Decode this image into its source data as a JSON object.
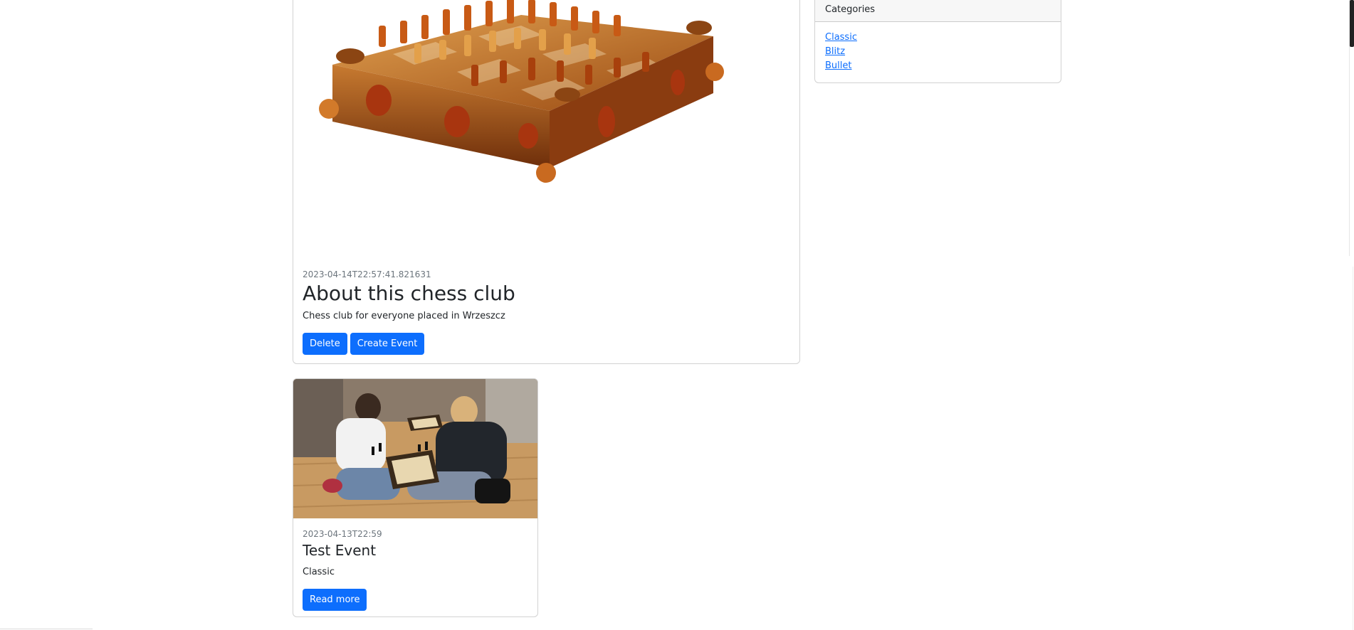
{
  "club": {
    "image_alt": "Amber chess set",
    "date": "2023-04-14T22:57:41.821631",
    "title": "About this chess club",
    "description": "Chess club for everyone placed in Wrzeszcz",
    "delete_label": "Delete",
    "create_event_label": "Create Event"
  },
  "event": {
    "image_alt": "Two boys playing chess on the floor",
    "date": "2023-04-13T22:59",
    "title": "Test Event",
    "category": "Classic",
    "read_more_label": "Read more"
  },
  "categories": {
    "header": "Categories",
    "items": [
      "Classic",
      "Blitz",
      "Bullet"
    ]
  },
  "colors": {
    "primary": "#0d6efd",
    "muted": "#6c757d",
    "text": "#212529",
    "amber": "#b5651d"
  },
  "icons": {
    "scrollbar": "scrollbar-thumb"
  }
}
